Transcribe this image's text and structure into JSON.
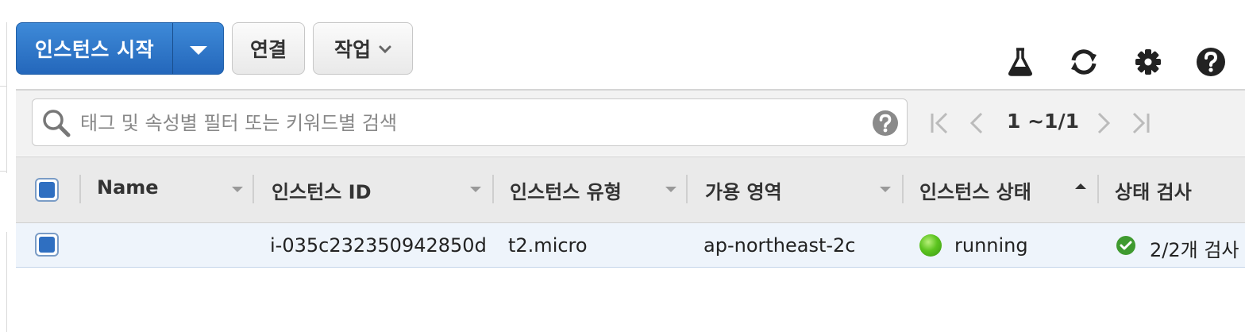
{
  "toolbar": {
    "launch_label": "인스턴스 시작",
    "connect_label": "연결",
    "actions_label": "작업",
    "icons": [
      "flask-icon",
      "refresh-icon",
      "gear-icon",
      "help-icon"
    ]
  },
  "search": {
    "placeholder": "태그 및 속성별 필터 또는 키워드별 검색"
  },
  "pager": {
    "range_text": "1 ~1/1"
  },
  "table": {
    "columns": [
      "Name",
      "인스턴스 ID",
      "인스턴스 유형",
      "가용 영역",
      "인스턴스 상태",
      "상태 검사"
    ],
    "sorted_column": "인스턴스 상태",
    "rows": [
      {
        "name": "",
        "instance_id": "i-035c232350942850d",
        "instance_type": "t2.micro",
        "availability_zone": "ap-northeast-2c",
        "instance_state": "running",
        "status_check": "2/2개 검사"
      }
    ]
  },
  "colors": {
    "primary": "#2467bb",
    "running": "#5cc41f",
    "check_ok": "#3f9a2f"
  }
}
